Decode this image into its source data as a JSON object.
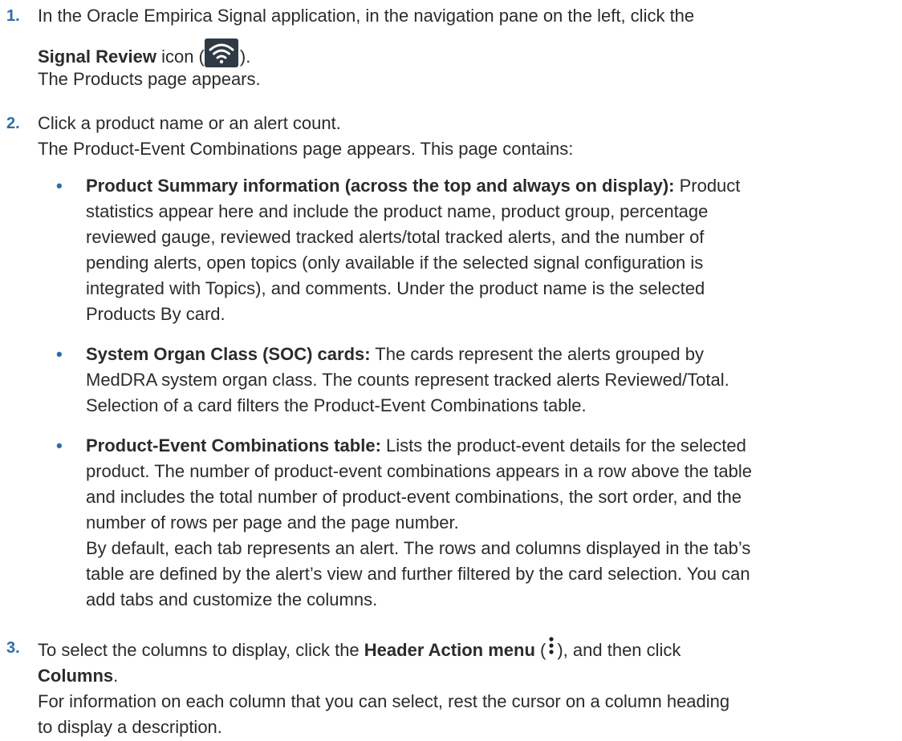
{
  "steps": [
    {
      "number": "1.",
      "line1": "In the Oracle Empirica Signal application, in the navigation pane on the left, click the",
      "bold1": "Signal Review",
      "after_bold1": " icon (",
      "after_icon": ").",
      "result": "The Products page appears.",
      "icon": "signal-review-wifi-icon"
    },
    {
      "number": "2.",
      "line1": "Click a product name or an alert count.",
      "result": "The Product-Event Combinations page appears. This page contains:",
      "bullets": [
        {
          "dot": "•",
          "bold": "Product Summary information (across the top and always on display):",
          "lines": [
            " Product",
            "statistics appear here and include the product name, product group, percentage",
            "reviewed gauge, reviewed tracked alerts/total tracked alerts, and the number of",
            "pending alerts, open topics (only available if the selected signal configuration is",
            "integrated with Topics), and comments. Under the product name is the selected",
            "Products By card."
          ]
        },
        {
          "dot": "•",
          "bold": "System Organ Class (SOC) cards:",
          "lines": [
            " The cards represent the alerts grouped by",
            "MedDRA system organ class. The counts represent tracked alerts Reviewed/Total.",
            "Selection of a card filters the Product-Event Combinations table."
          ]
        },
        {
          "dot": "•",
          "bold": "Product-Event Combinations table:",
          "lines": [
            " Lists the product-event details for the selected",
            "product. The number of product-event combinations appears in a row above the table",
            "and includes the total number of product-event combinations, the sort order, and the",
            "number of rows per page and the page number.",
            "By default, each tab represents an alert. The rows and columns displayed in the tab’s",
            "table are defined by the alert’s view and further filtered by the card selection. You can",
            "add tabs and customize the columns."
          ]
        }
      ]
    },
    {
      "number": "3.",
      "pre": "To select the columns to display, click the ",
      "bold1": "Header Action menu",
      "mid": " (",
      "after_icon": "), and then click",
      "bold2": "Columns",
      "after_bold2": ".",
      "result_lines": [
        "For information on each column that you can select, rest the cursor on a column heading",
        "to display a description."
      ],
      "icon": "kebab-menu-icon"
    }
  ]
}
